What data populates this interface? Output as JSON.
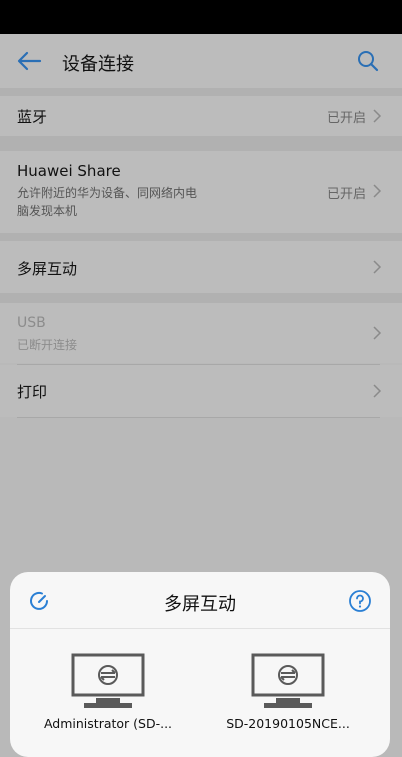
{
  "header": {
    "title": "设备连接"
  },
  "rows": {
    "bluetooth": {
      "label": "蓝牙",
      "value": "已开启"
    },
    "huawei_share": {
      "label": "Huawei Share",
      "sub_line1": "允许附近的华为设备、同网络内电",
      "sub_line2": "脑发现本机",
      "value": "已开启"
    },
    "multiscreen": {
      "label": "多屏互动"
    },
    "usb": {
      "label": "USB",
      "sub": "已断开连接"
    },
    "print": {
      "label": "打印"
    }
  },
  "sheet": {
    "title": "多屏互动",
    "devices": [
      {
        "name": "Administrator (SD-..."
      },
      {
        "name": "SD-20190105NCE..."
      }
    ]
  },
  "icons": [
    "back-arrow-icon",
    "search-icon",
    "chevron-right-icon",
    "refresh-icon",
    "help-icon",
    "monitor-icon"
  ],
  "colors": {
    "accent": "#2a7fd4",
    "overlay_bg": "#bcbcbc",
    "sheet_bg": "#f7f7f7"
  }
}
